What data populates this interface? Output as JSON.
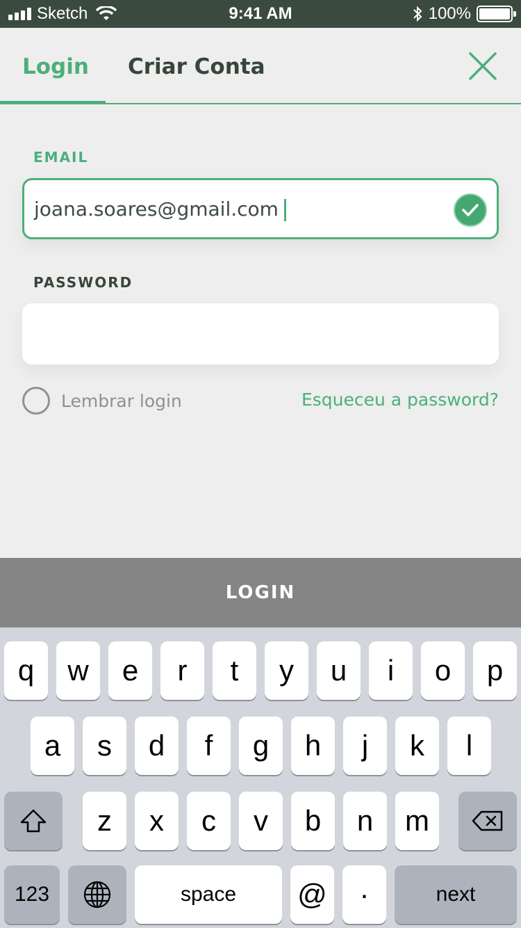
{
  "status_bar": {
    "carrier": "Sketch",
    "time": "9:41 AM",
    "battery": "100%"
  },
  "tabs": {
    "login": "Login",
    "create_account": "Criar Conta"
  },
  "form": {
    "email_label": "EMAIL",
    "email_value": "joana.soares@gmail.com",
    "password_label": "PASSWORD",
    "password_value": "",
    "remember_label": "Lembrar login",
    "forgot_link": "Esqueceu a password?"
  },
  "login_button": "LOGIN",
  "keyboard": {
    "row1": [
      "q",
      "w",
      "e",
      "r",
      "t",
      "y",
      "u",
      "i",
      "o",
      "p"
    ],
    "row2": [
      "a",
      "s",
      "d",
      "f",
      "g",
      "h",
      "j",
      "k",
      "l"
    ],
    "row3": [
      "z",
      "x",
      "c",
      "v",
      "b",
      "n",
      "m"
    ],
    "numbers_key": "123",
    "space_key": "space",
    "at_key": "@",
    "dot_key": "·",
    "next_key": "next"
  },
  "colors": {
    "accent": "#4caf7a",
    "status_bar": "#3b4a3f",
    "login_bar": "#858585"
  }
}
